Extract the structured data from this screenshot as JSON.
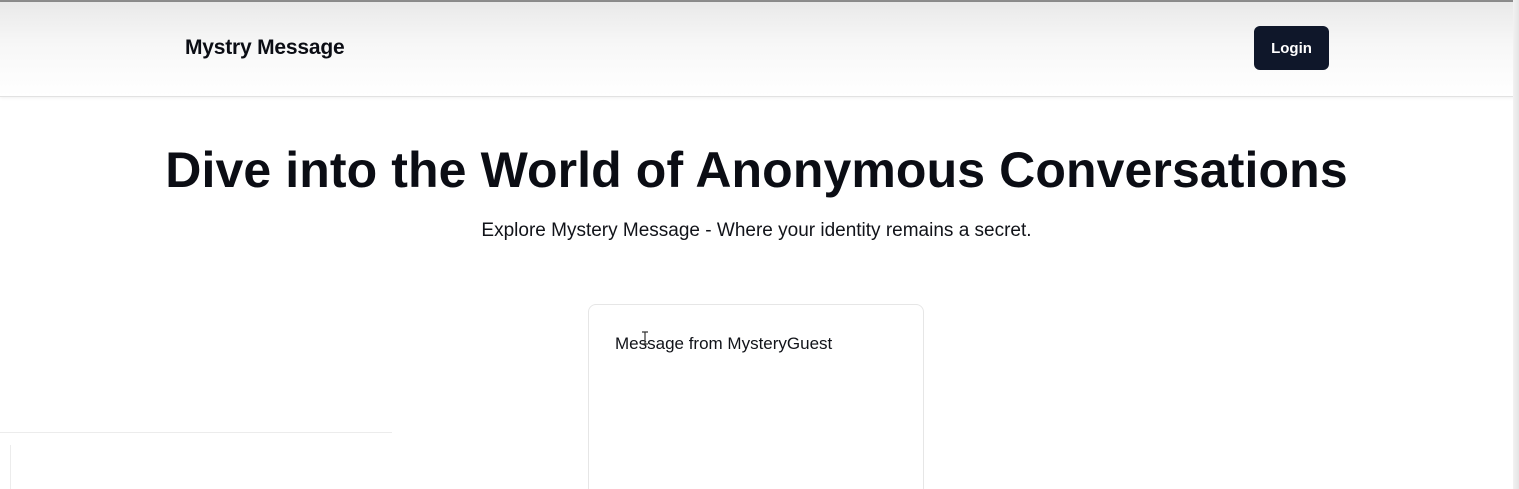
{
  "navbar": {
    "brand": "Mystry Message",
    "login_label": "Login"
  },
  "hero": {
    "title": "Dive into the World of Anonymous Conversations",
    "subtitle": "Explore Mystery Message - Where your identity remains a secret."
  },
  "card": {
    "title": "Message from MysteryGuest"
  },
  "colors": {
    "primary_button": "#0f172a",
    "text": "#0b0d14",
    "card_border": "#e6e6e6"
  },
  "icons": {
    "cursor": "text-cursor-icon"
  }
}
